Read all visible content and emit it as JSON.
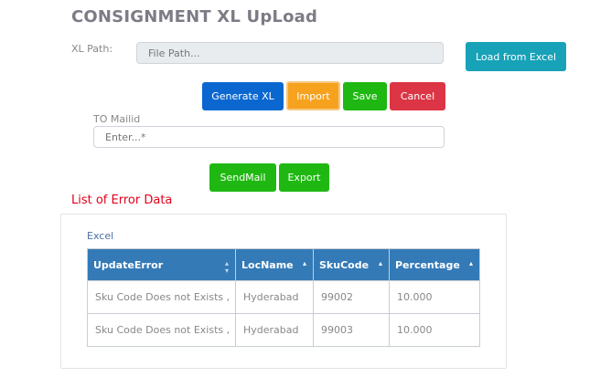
{
  "page": {
    "title": "CONSIGNMENT XL UpLoad"
  },
  "form": {
    "xl_path_label": "XL Path:",
    "xl_path_placeholder": "File Path...",
    "load_button": "Load from Excel",
    "generate_button": "Generate XL",
    "import_button": "Import",
    "save_button": "Save",
    "cancel_button": "Cancel",
    "to_mail_label": "TO Mailid",
    "to_mail_placeholder": "Enter...*",
    "sendmail_button": "SendMail",
    "export_button": "Export"
  },
  "errors": {
    "title": "List of Error Data",
    "excel_link": "Excel",
    "columns": [
      "UpdateError",
      "LocName",
      "SkuCode",
      "Percentage"
    ],
    "rows": [
      [
        "Sku Code Does not Exists ,",
        "Hyderabad",
        "99002",
        "10.000"
      ],
      [
        "Sku Code Does not Exists ,",
        "Hyderabad",
        "99003",
        "10.000"
      ]
    ]
  },
  "colors": {
    "header_bg": "#337ab7",
    "load": "#17a2b8",
    "generate": "#0b67d0",
    "import": "#f6a21e",
    "save": "#1fb812",
    "cancel": "#dc3545",
    "error_title": "#e0001a"
  }
}
